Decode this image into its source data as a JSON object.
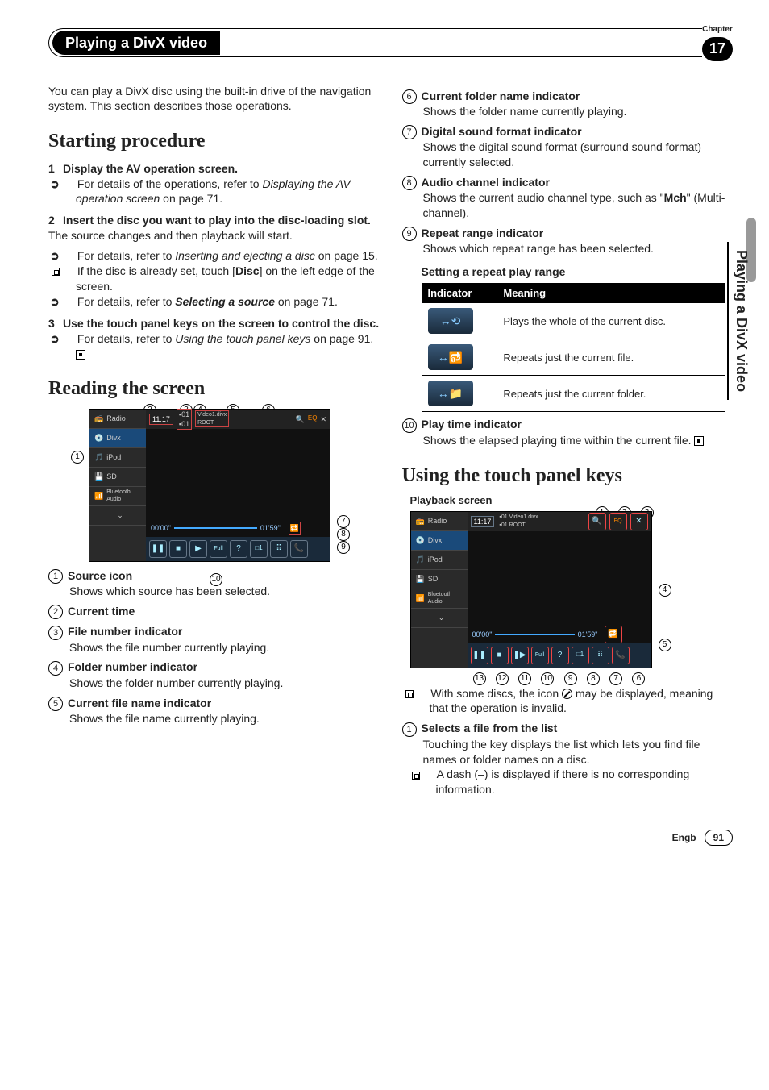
{
  "header": {
    "title": "Playing a DivX video",
    "chapter_label": "Chapter",
    "chapter_number": "17"
  },
  "side_tab": "Playing a DivX video",
  "intro": "You can play a DivX disc using the built-in drive of the navigation system. This section describes those operations.",
  "sec1": {
    "heading": "Starting procedure",
    "step1_head": "Display the AV operation screen.",
    "step1_sub_a": "For details of the operations, refer to ",
    "step1_sub_b": "Displaying the AV operation screen",
    "step1_sub_c": " on page 71.",
    "step2_head": "Insert the disc you want to play into the disc-loading slot.",
    "step2_desc": "The source changes and then playback will start.",
    "step2_sub1_a": "For details, refer to ",
    "step2_sub1_b": "Inserting and ejecting a disc",
    "step2_sub1_c": " on page 15.",
    "step2_sub2_a": "If the disc is already set, touch [",
    "step2_sub2_b": "Disc",
    "step2_sub2_c": "] on the left edge of the screen.",
    "step2_sub3_a": "For details, refer to ",
    "step2_sub3_b": "Selecting a source",
    "step2_sub3_c": " on page 71.",
    "step3_head": "Use the touch panel keys on the screen to control the disc.",
    "step3_sub_a": "For details, refer to ",
    "step3_sub_b": "Using the touch panel keys",
    "step3_sub_c": " on page 91."
  },
  "sec2": {
    "heading": "Reading the screen",
    "items": [
      {
        "n": "1",
        "t": "Source icon",
        "d": "Shows which source has been selected."
      },
      {
        "n": "2",
        "t": "Current time",
        "d": ""
      },
      {
        "n": "3",
        "t": "File number indicator",
        "d": "Shows the file number currently playing."
      },
      {
        "n": "4",
        "t": "Folder number indicator",
        "d": "Shows the folder number currently playing."
      },
      {
        "n": "5",
        "t": "Current file name indicator",
        "d": "Shows the file name currently playing."
      }
    ]
  },
  "rightTop": {
    "items": [
      {
        "n": "6",
        "t": "Current folder name indicator",
        "d": "Shows the folder name currently playing."
      },
      {
        "n": "7",
        "t": "Digital sound format indicator",
        "d": "Shows the digital sound format (surround sound format) currently selected."
      },
      {
        "n": "8",
        "t": "Audio channel indicator",
        "d": "Shows the current audio channel type, such as \"Mch\" (Multi-channel).",
        "bold": "Mch"
      },
      {
        "n": "9",
        "t": "Repeat range indicator",
        "d": "Shows which repeat range has been selected."
      }
    ],
    "table_title": "Setting a repeat play range",
    "th1": "Indicator",
    "th2": "Meaning",
    "rows": [
      "Plays the whole of the current disc.",
      "Repeats just the current file.",
      "Repeats just the current folder."
    ],
    "item10_n": "10",
    "item10_t": "Play time indicator",
    "item10_d": "Shows the elapsed playing time within the current file."
  },
  "sec3": {
    "heading": "Using the touch panel keys",
    "fig_label": "Playback screen",
    "note_a": "With some discs, the icon ",
    "note_b": " may be displayed, meaning that the operation is invalid.",
    "item1_n": "1",
    "item1_t": "Selects a file from the list",
    "item1_d": "Touching the key displays the list which lets you find file names or folder names on a disc.",
    "item1_sub": "A dash (–) is displayed if there is no corresponding information."
  },
  "screenshot": {
    "sources": [
      "Radio",
      "Divx",
      "iPod",
      "SD",
      "Bluetooth Audio"
    ],
    "time": "11:17",
    "file": "01",
    "folder": "01",
    "filename": "Video1.divx",
    "foldername": "ROOT",
    "elapsed": "00'00\"",
    "total": "01'59\"",
    "callouts_top": [
      "2",
      "3",
      "4",
      "5",
      "6"
    ],
    "callouts_right": [
      "7",
      "8",
      "9"
    ],
    "callout_left": "1",
    "callout_bottom": "10"
  },
  "screenshot2": {
    "callouts_top": [
      "1",
      "2",
      "3"
    ],
    "callouts_right": [
      "4",
      "5"
    ],
    "callouts_bottom": [
      "13",
      "12",
      "11",
      "10",
      "9",
      "8",
      "7",
      "6"
    ]
  },
  "footer": {
    "lang": "Engb",
    "page": "91"
  }
}
